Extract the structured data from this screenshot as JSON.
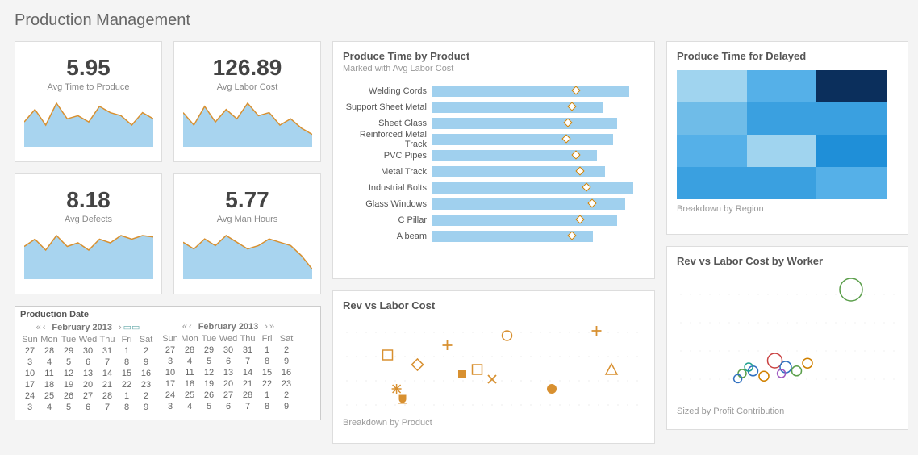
{
  "page_title": "Production Management",
  "kpis": [
    {
      "value": "5.95",
      "label": "Avg Time to Produce",
      "spark": [
        40,
        60,
        35,
        70,
        45,
        50,
        40,
        65,
        55,
        50,
        35,
        55,
        45
      ]
    },
    {
      "value": "126.89",
      "label": "Avg Labor Cost",
      "spark": [
        55,
        35,
        65,
        40,
        60,
        45,
        70,
        50,
        55,
        35,
        45,
        30,
        20
      ]
    },
    {
      "value": "8.18",
      "label": "Avg Defects",
      "spark": [
        45,
        55,
        40,
        60,
        45,
        50,
        40,
        55,
        50,
        60,
        55,
        60,
        58
      ]
    },
    {
      "value": "5.77",
      "label": "Avg Man Hours",
      "spark": [
        55,
        45,
        60,
        50,
        65,
        55,
        45,
        50,
        60,
        55,
        50,
        35,
        15
      ]
    }
  ],
  "produce_time": {
    "title": "Produce Time by Product",
    "subtitle": "Marked with Avg Labor Cost"
  },
  "rev_vs_labor": {
    "title": "Rev vs Labor Cost",
    "footnote": "Breakdown by Product"
  },
  "heat": {
    "title": "Produce Time for Delayed",
    "footnote": "Breakdown by Region"
  },
  "worker": {
    "title": "Rev vs Labor Cost by Worker",
    "footnote": "Sized by Profit Contribution"
  },
  "calendar": {
    "title": "Production Date",
    "month_label": "February 2013",
    "dows": [
      "Sun",
      "Mon",
      "Tue",
      "Wed",
      "Thu",
      "Fri",
      "Sat"
    ],
    "weeks": [
      [
        "27",
        "28",
        "29",
        "30",
        "31",
        "1",
        "2"
      ],
      [
        "3",
        "4",
        "5",
        "6",
        "7",
        "8",
        "9"
      ],
      [
        "10",
        "11",
        "12",
        "13",
        "14",
        "15",
        "16"
      ],
      [
        "17",
        "18",
        "19",
        "20",
        "21",
        "22",
        "23"
      ],
      [
        "24",
        "25",
        "26",
        "27",
        "28",
        "1",
        "2"
      ],
      [
        "3",
        "4",
        "5",
        "6",
        "7",
        "8",
        "9"
      ]
    ]
  },
  "chart_data": [
    {
      "type": "bar",
      "title": "Produce Time by Product",
      "orientation": "horizontal",
      "categories": [
        "Welding Cords",
        "Support Sheet Metal",
        "Sheet Glass",
        "Reinforced Metal Track",
        "PVC Pipes",
        "Metal Track",
        "Industrial Bolts",
        "Glass Windows",
        "C Pillar",
        "A beam"
      ],
      "values": [
        98,
        85,
        92,
        90,
        82,
        86,
        100,
        96,
        92,
        80
      ],
      "marker_series": {
        "name": "Avg Labor Cost",
        "values": [
          70,
          68,
          66,
          65,
          70,
          72,
          75,
          78,
          72,
          68
        ]
      },
      "xlabel": "",
      "ylabel": "",
      "xlim": [
        0,
        100
      ]
    },
    {
      "type": "line",
      "title": "Avg Time to Produce sparkline",
      "x": [
        1,
        2,
        3,
        4,
        5,
        6,
        7,
        8,
        9,
        10,
        11,
        12,
        13
      ],
      "values": [
        40,
        60,
        35,
        70,
        45,
        50,
        40,
        65,
        55,
        50,
        35,
        55,
        45
      ]
    },
    {
      "type": "line",
      "title": "Avg Labor Cost sparkline",
      "x": [
        1,
        2,
        3,
        4,
        5,
        6,
        7,
        8,
        9,
        10,
        11,
        12,
        13
      ],
      "values": [
        55,
        35,
        65,
        40,
        60,
        45,
        70,
        50,
        55,
        35,
        45,
        30,
        20
      ]
    },
    {
      "type": "line",
      "title": "Avg Defects sparkline",
      "x": [
        1,
        2,
        3,
        4,
        5,
        6,
        7,
        8,
        9,
        10,
        11,
        12,
        13
      ],
      "values": [
        45,
        55,
        40,
        60,
        45,
        50,
        40,
        55,
        50,
        60,
        55,
        60,
        58
      ]
    },
    {
      "type": "line",
      "title": "Avg Man Hours sparkline",
      "x": [
        1,
        2,
        3,
        4,
        5,
        6,
        7,
        8,
        9,
        10,
        11,
        12,
        13
      ],
      "values": [
        55,
        45,
        60,
        50,
        65,
        55,
        45,
        50,
        60,
        55,
        50,
        35,
        15
      ]
    },
    {
      "type": "scatter",
      "title": "Rev vs Labor Cost",
      "footnote": "Breakdown by Product",
      "series": [
        {
          "name": "product",
          "points": [
            {
              "x": 15,
              "y": 60,
              "shape": "square-open"
            },
            {
              "x": 25,
              "y": 50,
              "shape": "diamond-open"
            },
            {
              "x": 18,
              "y": 25,
              "shape": "asterisk"
            },
            {
              "x": 20,
              "y": 15,
              "shape": "trophy"
            },
            {
              "x": 35,
              "y": 70,
              "shape": "plus"
            },
            {
              "x": 40,
              "y": 40,
              "shape": "square-solid"
            },
            {
              "x": 45,
              "y": 45,
              "shape": "square-open"
            },
            {
              "x": 50,
              "y": 35,
              "shape": "x"
            },
            {
              "x": 55,
              "y": 80,
              "shape": "circle-open"
            },
            {
              "x": 70,
              "y": 25,
              "shape": "circle-solid"
            },
            {
              "x": 85,
              "y": 85,
              "shape": "plus"
            },
            {
              "x": 90,
              "y": 45,
              "shape": "triangle-open"
            }
          ]
        }
      ],
      "xlim": [
        0,
        100
      ],
      "ylim": [
        0,
        100
      ]
    },
    {
      "type": "heatmap",
      "title": "Produce Time for Delayed",
      "footnote": "Breakdown by Region",
      "rows": 4,
      "cols": 3,
      "values": [
        [
          35,
          50,
          95
        ],
        [
          45,
          60,
          55
        ],
        [
          50,
          25,
          70
        ],
        [
          55,
          58,
          52
        ]
      ],
      "range": [
        0,
        100
      ]
    },
    {
      "type": "scatter",
      "title": "Rev vs Labor Cost by Worker",
      "footnote": "Sized by Profit Contribution",
      "series": [
        {
          "name": "workers",
          "points": [
            {
              "x": 80,
              "y": 85,
              "r": 14,
              "color": "#5a9e4a"
            },
            {
              "x": 45,
              "y": 30,
              "r": 9,
              "color": "#c94040"
            },
            {
              "x": 50,
              "y": 25,
              "r": 7,
              "color": "#3070c0"
            },
            {
              "x": 35,
              "y": 22,
              "r": 6,
              "color": "#3070c0"
            },
            {
              "x": 40,
              "y": 18,
              "r": 6,
              "color": "#d08000"
            },
            {
              "x": 30,
              "y": 20,
              "r": 5,
              "color": "#5a9e4a"
            },
            {
              "x": 55,
              "y": 22,
              "r": 6,
              "color": "#5a9e4a"
            },
            {
              "x": 28,
              "y": 16,
              "r": 5,
              "color": "#3070c0"
            },
            {
              "x": 60,
              "y": 28,
              "r": 6,
              "color": "#d08000"
            },
            {
              "x": 48,
              "y": 20,
              "r": 5,
              "color": "#a05ac0"
            },
            {
              "x": 33,
              "y": 25,
              "r": 5,
              "color": "#20a090"
            }
          ]
        }
      ],
      "xlim": [
        0,
        100
      ],
      "ylim": [
        0,
        100
      ]
    }
  ]
}
